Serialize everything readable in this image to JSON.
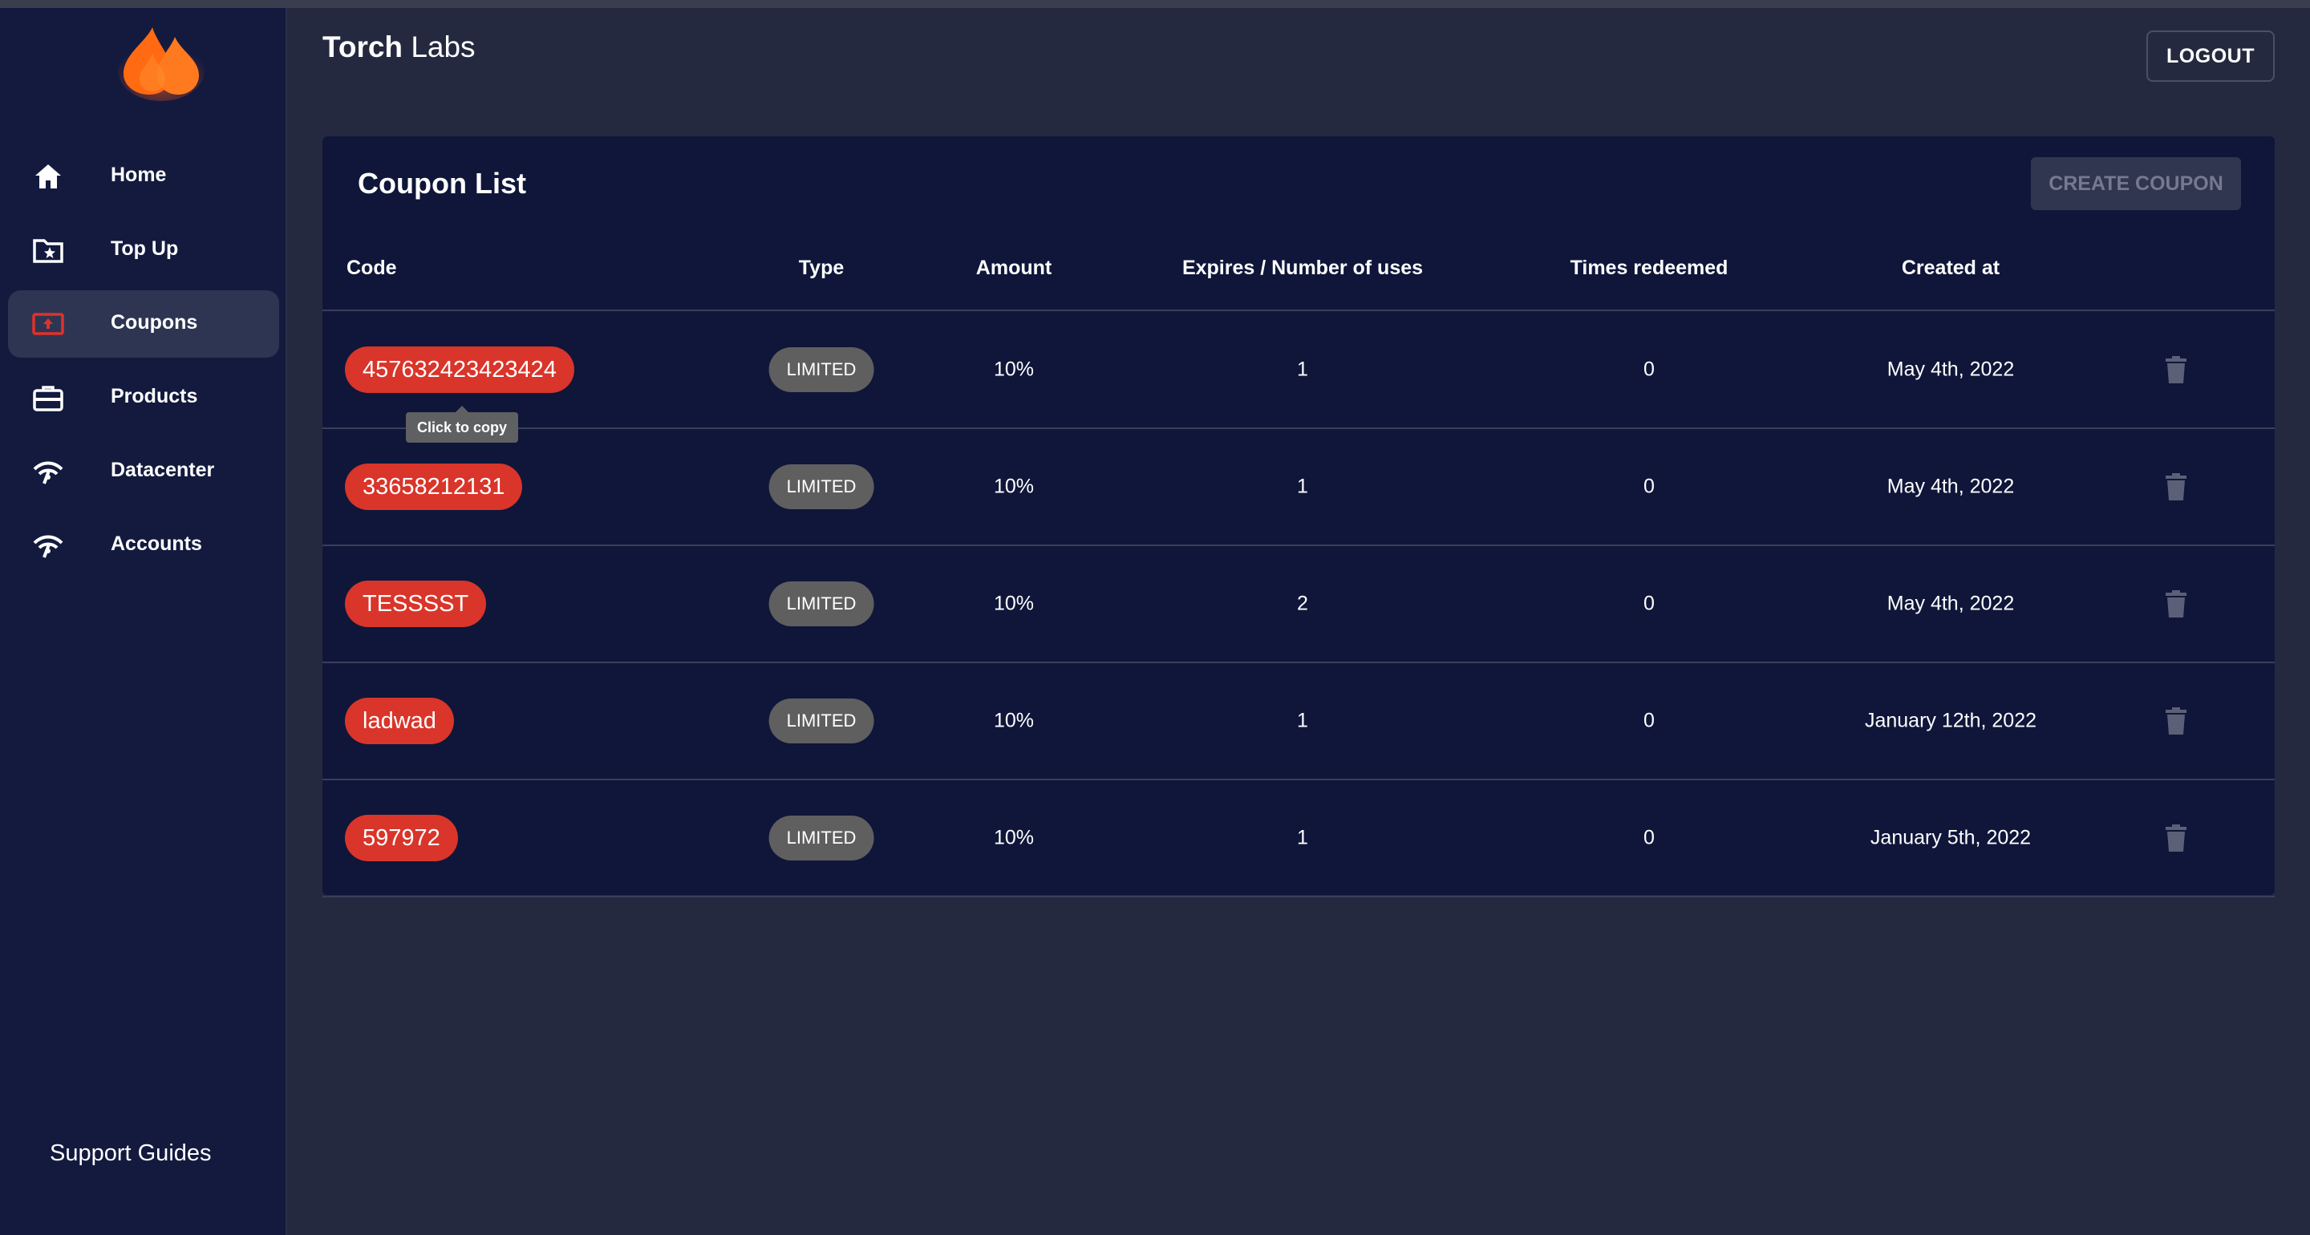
{
  "brand": {
    "bold": "Torch",
    "rest": " Labs"
  },
  "header": {
    "logout_label": "LOGOUT"
  },
  "sidebar": {
    "items": [
      {
        "label": "Home",
        "icon": "home-icon",
        "active": false
      },
      {
        "label": "Top Up",
        "icon": "folder-star-icon",
        "active": false
      },
      {
        "label": "Coupons",
        "icon": "coupon-icon",
        "active": true
      },
      {
        "label": "Products",
        "icon": "briefcase-icon",
        "active": false
      },
      {
        "label": "Datacenter",
        "icon": "wifi-icon",
        "active": false
      },
      {
        "label": "Accounts",
        "icon": "wifi-icon",
        "active": false
      }
    ],
    "support_label": "Support Guides"
  },
  "coupons": {
    "title": "Coupon List",
    "create_label": "CREATE COUPON",
    "columns": [
      "Code",
      "Type",
      "Amount",
      "Expires / Number of uses",
      "Times redeemed",
      "Created at"
    ],
    "rows": [
      {
        "code": "457632423423424",
        "type": "LIMITED",
        "amount": "10%",
        "uses": "1",
        "redeemed": "0",
        "created": "May 4th, 2022"
      },
      {
        "code": "33658212131",
        "type": "LIMITED",
        "amount": "10%",
        "uses": "1",
        "redeemed": "0",
        "created": "May 4th, 2022"
      },
      {
        "code": "TESSSST",
        "type": "LIMITED",
        "amount": "10%",
        "uses": "2",
        "redeemed": "0",
        "created": "May 4th, 2022"
      },
      {
        "code": "ladwad",
        "type": "LIMITED",
        "amount": "10%",
        "uses": "1",
        "redeemed": "0",
        "created": "January 12th, 2022"
      },
      {
        "code": "597972",
        "type": "LIMITED",
        "amount": "10%",
        "uses": "1",
        "redeemed": "0",
        "created": "January 5th, 2022"
      }
    ],
    "tooltip": "Click to copy"
  },
  "colors": {
    "accent": "#d9352a",
    "sidebar_bg": "#131a3e",
    "page_bg": "#25293f",
    "card_bg": "#0f1639"
  }
}
